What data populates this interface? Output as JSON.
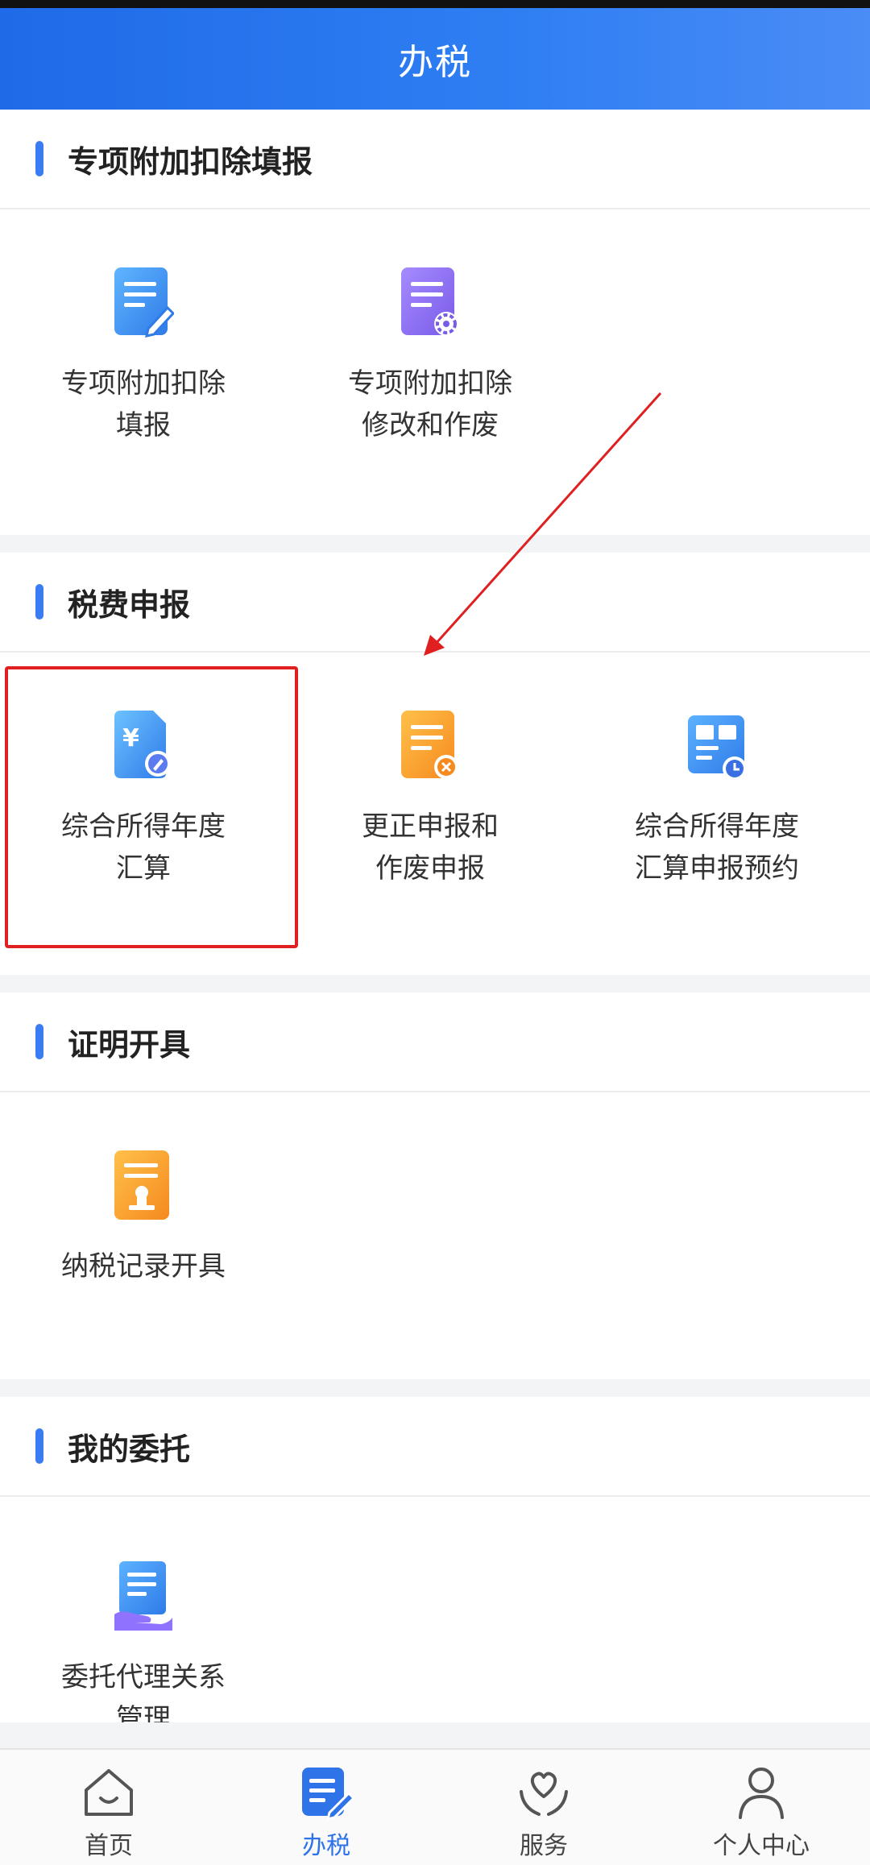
{
  "header": {
    "title": "办税"
  },
  "sections": [
    {
      "title": "专项附加扣除填报",
      "items": [
        {
          "line1": "专项附加扣除",
          "line2": "填报",
          "icon": "document-edit-icon"
        },
        {
          "line1": "专项附加扣除",
          "line2": "修改和作废",
          "icon": "document-settings-icon"
        }
      ]
    },
    {
      "title": "税费申报",
      "items": [
        {
          "line1": "综合所得年度",
          "line2": "汇算",
          "icon": "yuan-document-edit-icon"
        },
        {
          "line1": "更正申报和",
          "line2": "作废申报",
          "icon": "document-cancel-icon"
        },
        {
          "line1": "综合所得年度",
          "line2": "汇算申报预约",
          "icon": "calendar-clock-icon"
        }
      ]
    },
    {
      "title": "证明开具",
      "items": [
        {
          "line1": "纳税记录开具",
          "line2": "",
          "icon": "document-stamp-icon"
        }
      ]
    },
    {
      "title": "我的委托",
      "items": [
        {
          "line1": "委托代理关系",
          "line2": "管理",
          "icon": "document-hand-icon"
        }
      ]
    }
  ],
  "tabbar": [
    {
      "label": "首页",
      "icon": "home-icon",
      "active": false
    },
    {
      "label": "办税",
      "icon": "tax-edit-icon",
      "active": true
    },
    {
      "label": "服务",
      "icon": "heart-hands-icon",
      "active": false
    },
    {
      "label": "个人中心",
      "icon": "person-icon",
      "active": false
    }
  ],
  "colors": {
    "brand_blue": "#2f73e8",
    "highlight_red": "#e02020"
  }
}
